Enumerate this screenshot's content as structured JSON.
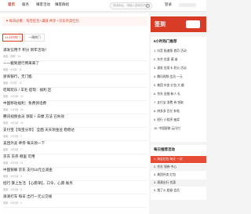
{
  "nav": {
    "items": [
      "首页",
      "服务",
      "赚客活动",
      "赚客群组"
    ],
    "search_placeholder": "搜索网址，请输入搜索的内容",
    "login": "登录"
  },
  "notice": "✦ 每日必看：淘宝红包+满减 共享 +京东外卖红包",
  "tabs": [
    "24小时热门",
    "一周热门"
  ],
  "posts": [
    {
      "title": "浦发信用卡 积分 新年活动！",
      "meta": "赚客 · 刚刚 · 56"
    },
    {
      "title": "一一搬到建行用来来了",
      "meta": "赚客 · 5分钟 · 31"
    },
    {
      "title": "浙商银行，无门槛",
      "meta": "赚客 · 8分钟 · 12"
    },
    {
      "title": "吃喝玩乐 / 羊毛 提现：福利 区",
      "meta": "赚客 · 10分钟 · 20"
    },
    {
      "title": "中国移动福利：免费领话费",
      "meta": "赚客 · 12分钟 · 15"
    },
    {
      "title": "腾讯视频会员 领取 + 白嫖 方法 已失效",
      "meta": "赚客 · 16分钟 · 43"
    },
    {
      "title": "支付宝【淘宝分享】  全面 天天领金豆 稳稳达",
      "meta": "赚客 · 20分钟 · 9"
    },
    {
      "title": "美团外卖 神券 每天领一下",
      "meta": "赚客 · 25分钟 · 7"
    },
    {
      "title": "京东 东券 哪里 可用",
      "meta": "赚客 · 30分钟 · 11"
    },
    {
      "title": "中国银联 京东 支付10元立减金",
      "meta": "赚客 · 36分钟 · 6"
    },
    {
      "title": "招行 掌上生活 【心愿单】，口令，心愿 账务",
      "meta": "赚客 · 40分钟 · 8"
    },
    {
      "title": "滴滴打车 每日 出行一元公交线",
      "meta": "赚客 · 45分钟 · 3"
    }
  ],
  "right": {
    "banner": "签到",
    "hot_title": "6小时热门推荐",
    "hot_items": [
      "1. 抖音 极速版 首页 活动",
      "2. 东京 优惠 满 减",
      "3. 浦发 信用卡 积分 活动",
      "4. 腾讯视频 会员 一元",
      "5. 美团 外卖 红包 大 额",
      "6. 京东 金融 新人 礼",
      "7. 支付宝 消费 券 领取",
      "8. 拼多多 百亿 补贴",
      "9. 招行 小程序 抽奖",
      "10. 中国银联 云闪付"
    ],
    "activity_title": "每日推荐活动",
    "activities": [
      "1. 淘宝红包 每天 一次",
      "2. 京东 领券 中心",
      "3. 美团外卖 红包",
      "4. 滴滴出行 优惠",
      "5. 饿了么 超级 会员"
    ]
  }
}
